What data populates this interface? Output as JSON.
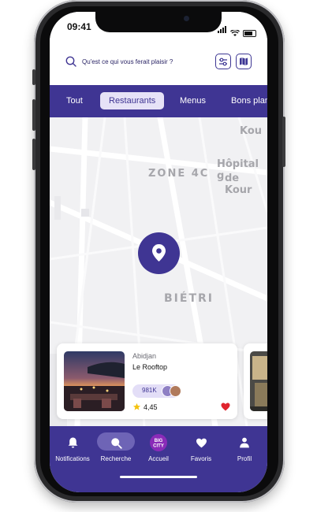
{
  "status_bar": {
    "time": "09:41"
  },
  "search": {
    "placeholder": "Qu'est ce qui vous ferait plaisir ?"
  },
  "tabs": [
    {
      "label": "Tout"
    },
    {
      "label": "Restaurants"
    },
    {
      "label": "Menus"
    },
    {
      "label": "Bons plans"
    }
  ],
  "active_tab": "Restaurants",
  "map": {
    "labels": {
      "zone": "ZONE 4C",
      "hospital": "Hôpital g",
      "hospital2": "de Kour",
      "district": "BIÉTRI",
      "top": "Kou"
    }
  },
  "card": {
    "city": "Abidjan",
    "name": "Le Rooftop",
    "likes": "981K",
    "rating": "4,45",
    "favorite": true
  },
  "nav": [
    {
      "label": "Notifications",
      "icon": "bell-icon"
    },
    {
      "label": "Recherche",
      "icon": "search-icon"
    },
    {
      "label": "Accueil",
      "icon": "big-city-logo",
      "logo_text": "BIG CITY"
    },
    {
      "label": "Favoris",
      "icon": "heart-icon"
    },
    {
      "label": "Profil",
      "icon": "user-icon"
    }
  ],
  "colors": {
    "brand": "#3f3593",
    "accent_light": "#e6e2f7",
    "heart": "#e0242e",
    "star": "#f4c20d"
  }
}
